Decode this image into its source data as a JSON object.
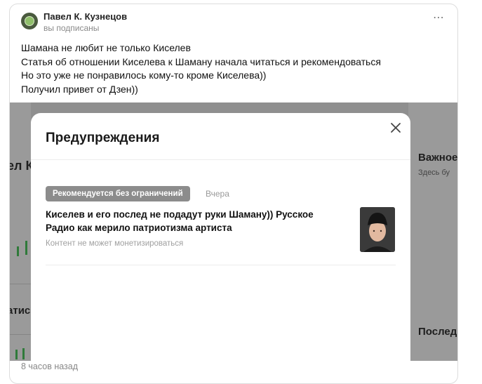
{
  "post": {
    "author": "Павел К. Кузнецов",
    "subscription_status": "вы подписаны",
    "text_lines": [
      "Шамана не любит не только Киселев",
      "Статья об отношении Киселева к Шаману начала читаться и рекомендоваться",
      "Но это уже не понравилось кому-то кроме Киселева))",
      "Получил привет от Дзен))"
    ],
    "timestamp": "8 часов назад",
    "more_icon": "⋯"
  },
  "background_fragments": {
    "left_1": "ел К",
    "left_2": "атис",
    "right_1": "Важное",
    "right_1_sub": "Здесь бу",
    "right_2": "Послед"
  },
  "modal": {
    "title": "Предупреждения",
    "close_icon": "close-icon",
    "item": {
      "badge": "Рекомендуется без ограничений",
      "date": "Вчера",
      "title": "Киселев и его послед не подадут руки Шаману)) Русское Радио как мерило патриотизма артиста",
      "note": "Контент не может монетизироваться"
    }
  }
}
